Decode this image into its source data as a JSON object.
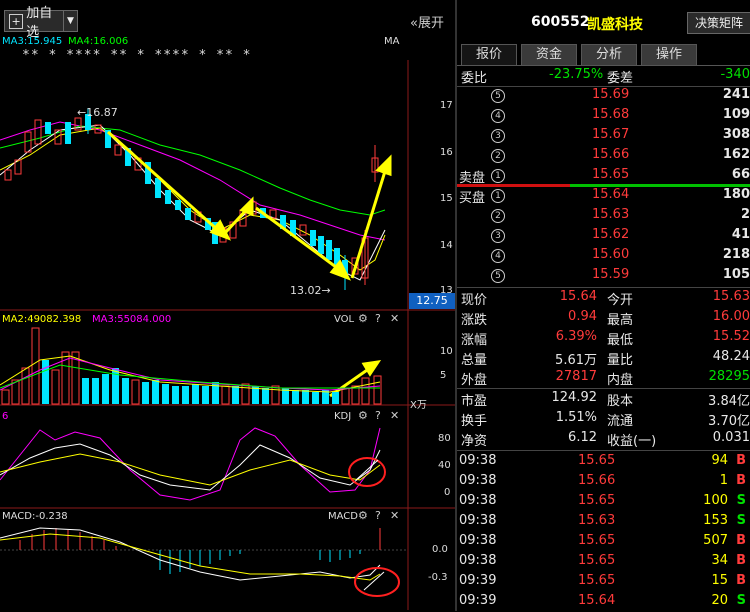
{
  "toolbar": {
    "add_label": "加自选",
    "expand_label": "展开"
  },
  "main_chart": {
    "ma_labels": [
      "MA3:15.945",
      "MA4:16.006",
      "MA"
    ],
    "stars": "** * **** ** * **** * ** *",
    "price_ticks": [
      "17",
      "16",
      "15",
      "14",
      "13"
    ],
    "high_note": "16.87",
    "low_note": "13.02",
    "current_price_tag": "12.75",
    "colors": {
      "up": "#ff3b3b",
      "down": "#00e5ff",
      "ma1": "#ffffff",
      "ma2": "#ffff00",
      "ma3": "#ff00ff",
      "ma4": "#00ff00",
      "arrow": "#ffff00"
    }
  },
  "vol_chart": {
    "labels": [
      "MA2:49082.398",
      "MA3:55084.000"
    ],
    "name": "VOL",
    "ticks": [
      "10",
      "5"
    ],
    "unit": "X万"
  },
  "kdj_chart": {
    "left_label": "6",
    "name": "KDJ",
    "ticks": [
      "80",
      "40",
      "0"
    ]
  },
  "macd_chart": {
    "label": "MACD:-0.238",
    "name": "MACD",
    "ticks": [
      "0.0",
      "-0.3"
    ]
  },
  "quote": {
    "code": "600552",
    "name": "凯盛科技",
    "decision_btn": "决策矩阵",
    "tabs": [
      "报价",
      "资金",
      "分析",
      "操作"
    ],
    "weibi": {
      "label": "委比",
      "value": "-23.75%",
      "diff_label": "委差",
      "diff": "-340"
    },
    "sell_label": "卖盘",
    "buy_label": "买盘",
    "asks": [
      {
        "lvl": "5",
        "price": "15.69",
        "vol": "241"
      },
      {
        "lvl": "4",
        "price": "15.68",
        "vol": "109"
      },
      {
        "lvl": "3",
        "price": "15.67",
        "vol": "308"
      },
      {
        "lvl": "2",
        "price": "15.66",
        "vol": "162"
      },
      {
        "lvl": "1",
        "price": "15.65",
        "vol": "66"
      }
    ],
    "bids": [
      {
        "lvl": "1",
        "price": "15.64",
        "vol": "180"
      },
      {
        "lvl": "2",
        "price": "15.63",
        "vol": "2"
      },
      {
        "lvl": "3",
        "price": "15.62",
        "vol": "41"
      },
      {
        "lvl": "4",
        "price": "15.60",
        "vol": "218"
      },
      {
        "lvl": "5",
        "price": "15.59",
        "vol": "105"
      }
    ],
    "stats1": [
      {
        "l": "现价",
        "v": "15.64",
        "l2": "今开",
        "v2": "15.63"
      },
      {
        "l": "涨跌",
        "v": "0.94",
        "l2": "最高",
        "v2": "16.00"
      },
      {
        "l": "涨幅",
        "v": "6.39%",
        "l2": "最低",
        "v2": "15.52"
      },
      {
        "l": "总量",
        "v": "5.61万",
        "l2": "量比",
        "v2": "48.24"
      },
      {
        "l": "外盘",
        "v": "27817",
        "l2": "内盘",
        "v2": "28295"
      }
    ],
    "stats2": [
      {
        "l": "市盈",
        "v": "124.92",
        "l2": "股本",
        "v2": "3.84亿"
      },
      {
        "l": "换手",
        "v": "1.51%",
        "l2": "流通",
        "v2": "3.70亿"
      },
      {
        "l": "净资",
        "v": "6.12",
        "l2": "收益(一)",
        "v2": "0.031"
      }
    ],
    "ticks": [
      {
        "t": "09:38",
        "p": "15.65",
        "v": "94",
        "s": "B"
      },
      {
        "t": "09:38",
        "p": "15.66",
        "v": "1",
        "s": "B"
      },
      {
        "t": "09:38",
        "p": "15.65",
        "v": "100",
        "s": "S"
      },
      {
        "t": "09:38",
        "p": "15.63",
        "v": "153",
        "s": "S"
      },
      {
        "t": "09:38",
        "p": "15.65",
        "v": "507",
        "s": "B"
      },
      {
        "t": "09:38",
        "p": "15.65",
        "v": "34",
        "s": "B"
      },
      {
        "t": "09:39",
        "p": "15.65",
        "v": "15",
        "s": "B"
      },
      {
        "t": "09:39",
        "p": "15.64",
        "v": "20",
        "s": "S"
      }
    ]
  }
}
